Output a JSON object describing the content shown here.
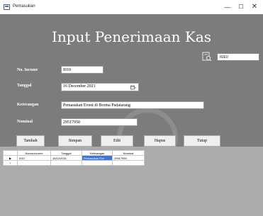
{
  "window": {
    "title": "Pemasukan",
    "minimize": "—",
    "maximize": "☐",
    "close": "✕"
  },
  "form": {
    "heading": "Input Penerimaan Kas",
    "search_value": "I010",
    "search_icon": "search-icon",
    "labels": {
      "no_income": "No. Income",
      "tanggal": "Tanggal",
      "keterangan": "Keterangan",
      "nominal": "Nominal"
    },
    "values": {
      "no_income": "I010",
      "tanggal": "16 December  2021",
      "keterangan": "Pemasukan Event di Borma Padalarang",
      "nominal": "29517950"
    }
  },
  "buttons": {
    "tambah": "Tambah",
    "simpan": "Simpan",
    "edit": "Edit",
    "hapus": "Hapus",
    "tutup": "Tutup"
  },
  "grid": {
    "columns": [
      "NomorIncome",
      "Tanggal",
      "Keterangan",
      "Nominal"
    ],
    "rows": [
      {
        "marker": "▶",
        "cells": [
          "I010",
          "16/12/2021",
          "Pemasukan Eve",
          "29517950"
        ]
      },
      {
        "marker": "*",
        "cells": [
          "",
          "",
          "",
          ""
        ]
      }
    ]
  },
  "colors": {
    "form_background": "#7c7c7c",
    "grid_background": "#ababab",
    "selected_cell": "#3d78d8"
  }
}
